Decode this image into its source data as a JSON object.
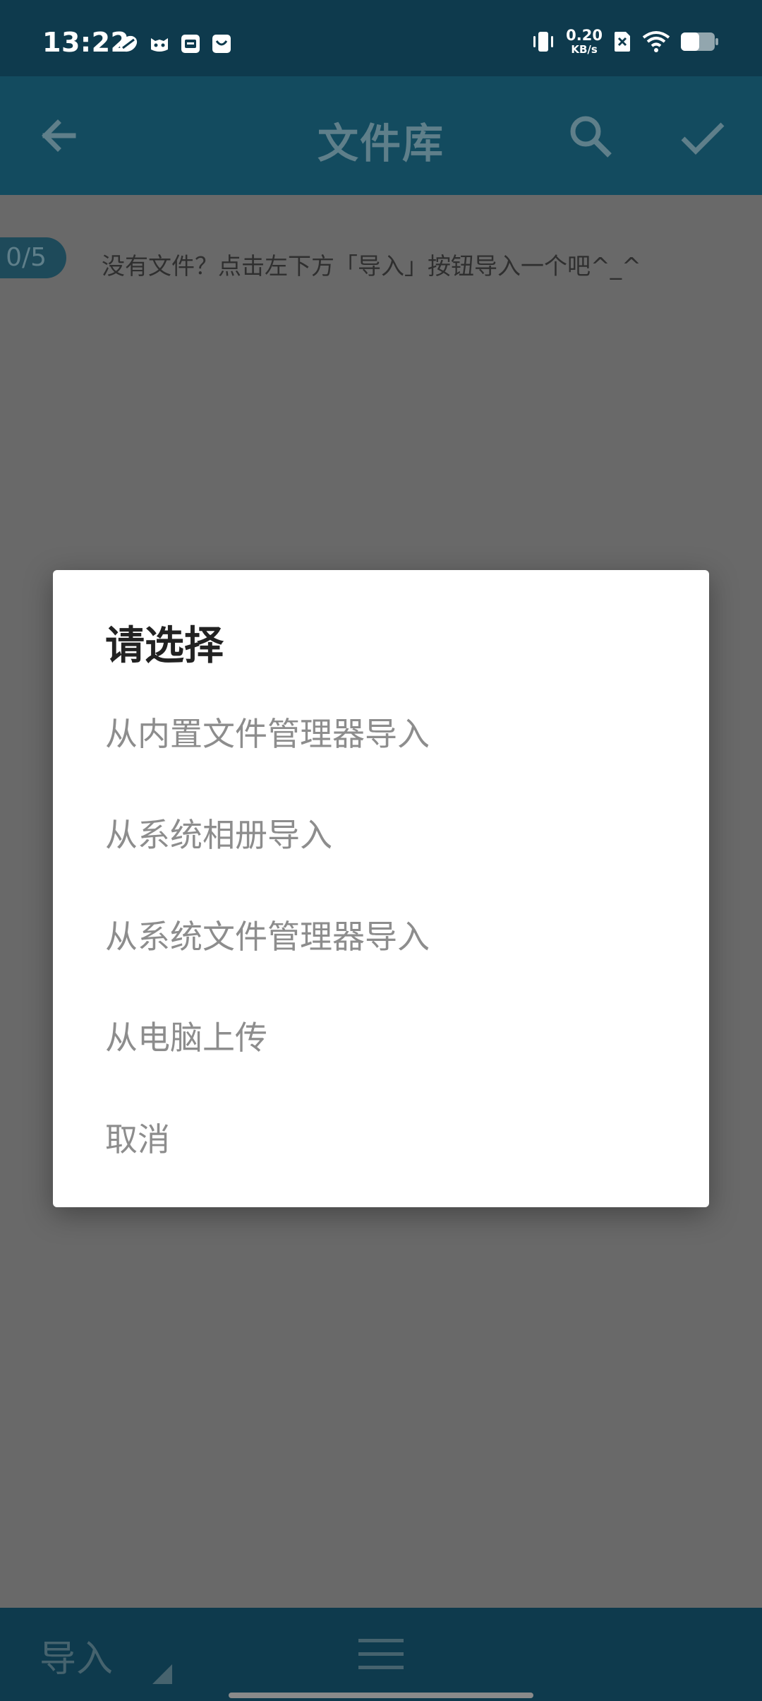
{
  "status_bar": {
    "time": "13:22",
    "app_icons": [
      "app-icon-1",
      "app-icon-2",
      "app-icon-3",
      "app-icon-4"
    ],
    "net_speed_value": "0.20",
    "net_speed_unit": "KB/s",
    "icons": [
      "vibrate-icon",
      "sim-off-icon",
      "wifi-icon",
      "battery-icon"
    ]
  },
  "toolbar": {
    "title": "文件库",
    "back_icon": "arrow-left-icon",
    "search_icon": "search-icon",
    "done_icon": "check-icon",
    "accent_color": "#134b5f"
  },
  "content": {
    "count_badge": "0/5",
    "empty_hint": "没有文件？点击左下方「导入」按钮导入一个吧^_^"
  },
  "dialog": {
    "title": "请选择",
    "options": [
      "从内置文件管理器导入",
      "从系统相册导入",
      "从系统文件管理器导入",
      "从电脑上传",
      "取消"
    ]
  },
  "bottom_bar": {
    "import_label": "导入",
    "menu_icon": "hamburger-menu-icon"
  }
}
